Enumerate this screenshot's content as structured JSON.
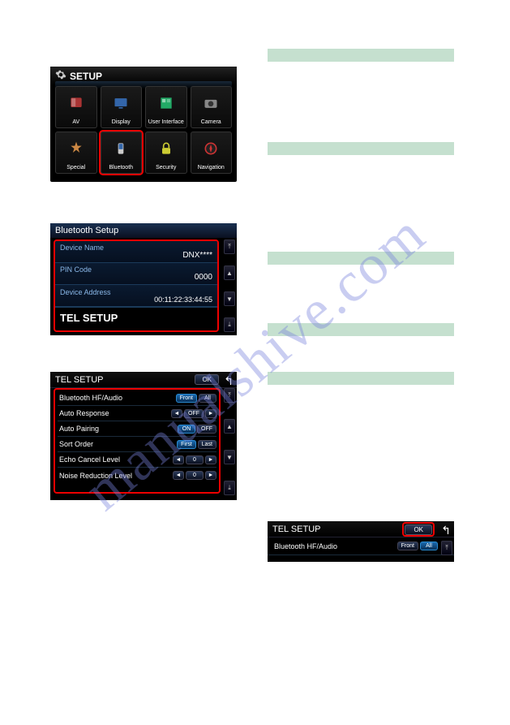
{
  "watermark": "manualshive.com",
  "shot1": {
    "title": "SETUP",
    "tiles": [
      {
        "label": "AV"
      },
      {
        "label": "Display"
      },
      {
        "label": "User Interface"
      },
      {
        "label": "Camera"
      },
      {
        "label": "Special"
      },
      {
        "label": "Bluetooth"
      },
      {
        "label": "Security"
      },
      {
        "label": "Navigation"
      }
    ]
  },
  "shot2": {
    "title": "Bluetooth Setup",
    "rows": {
      "device_name_label": "Device Name",
      "device_name_value": "DNX****",
      "pin_label": "PIN Code",
      "pin_value": "0000",
      "addr_label": "Device Address",
      "addr_value": "00:11:22:33:44:55",
      "telsetup": "TEL SETUP"
    }
  },
  "shot3": {
    "title": "TEL SETUP",
    "ok": "OK",
    "back": "↰",
    "rows": [
      {
        "label": "Bluetooth HF/Audio",
        "a": "Front",
        "b": "All",
        "sel": "a"
      },
      {
        "label": "Auto Response",
        "a": "◄",
        "mid": "OFF",
        "b": "►",
        "spinner": true
      },
      {
        "label": "Auto Pairing",
        "a": "ON",
        "b": "OFF",
        "sel": "a"
      },
      {
        "label": "Sort Order",
        "a": "First",
        "b": "Last",
        "sel": "a"
      },
      {
        "label": "Echo Cancel Level",
        "a": "◄",
        "mid": "0",
        "b": "►",
        "spinner": true
      },
      {
        "label": "Noise Reduction Level",
        "a": "◄",
        "mid": "0",
        "b": "►",
        "spinner": true
      }
    ]
  },
  "shot4": {
    "title": "TEL SETUP",
    "ok": "OK",
    "back": "↰",
    "row_label": "Bluetooth HF/Audio",
    "a": "Front",
    "b": "All"
  },
  "icons": {
    "top": "⤒",
    "up": "▲",
    "down": "▼",
    "bottom": "⤓"
  }
}
